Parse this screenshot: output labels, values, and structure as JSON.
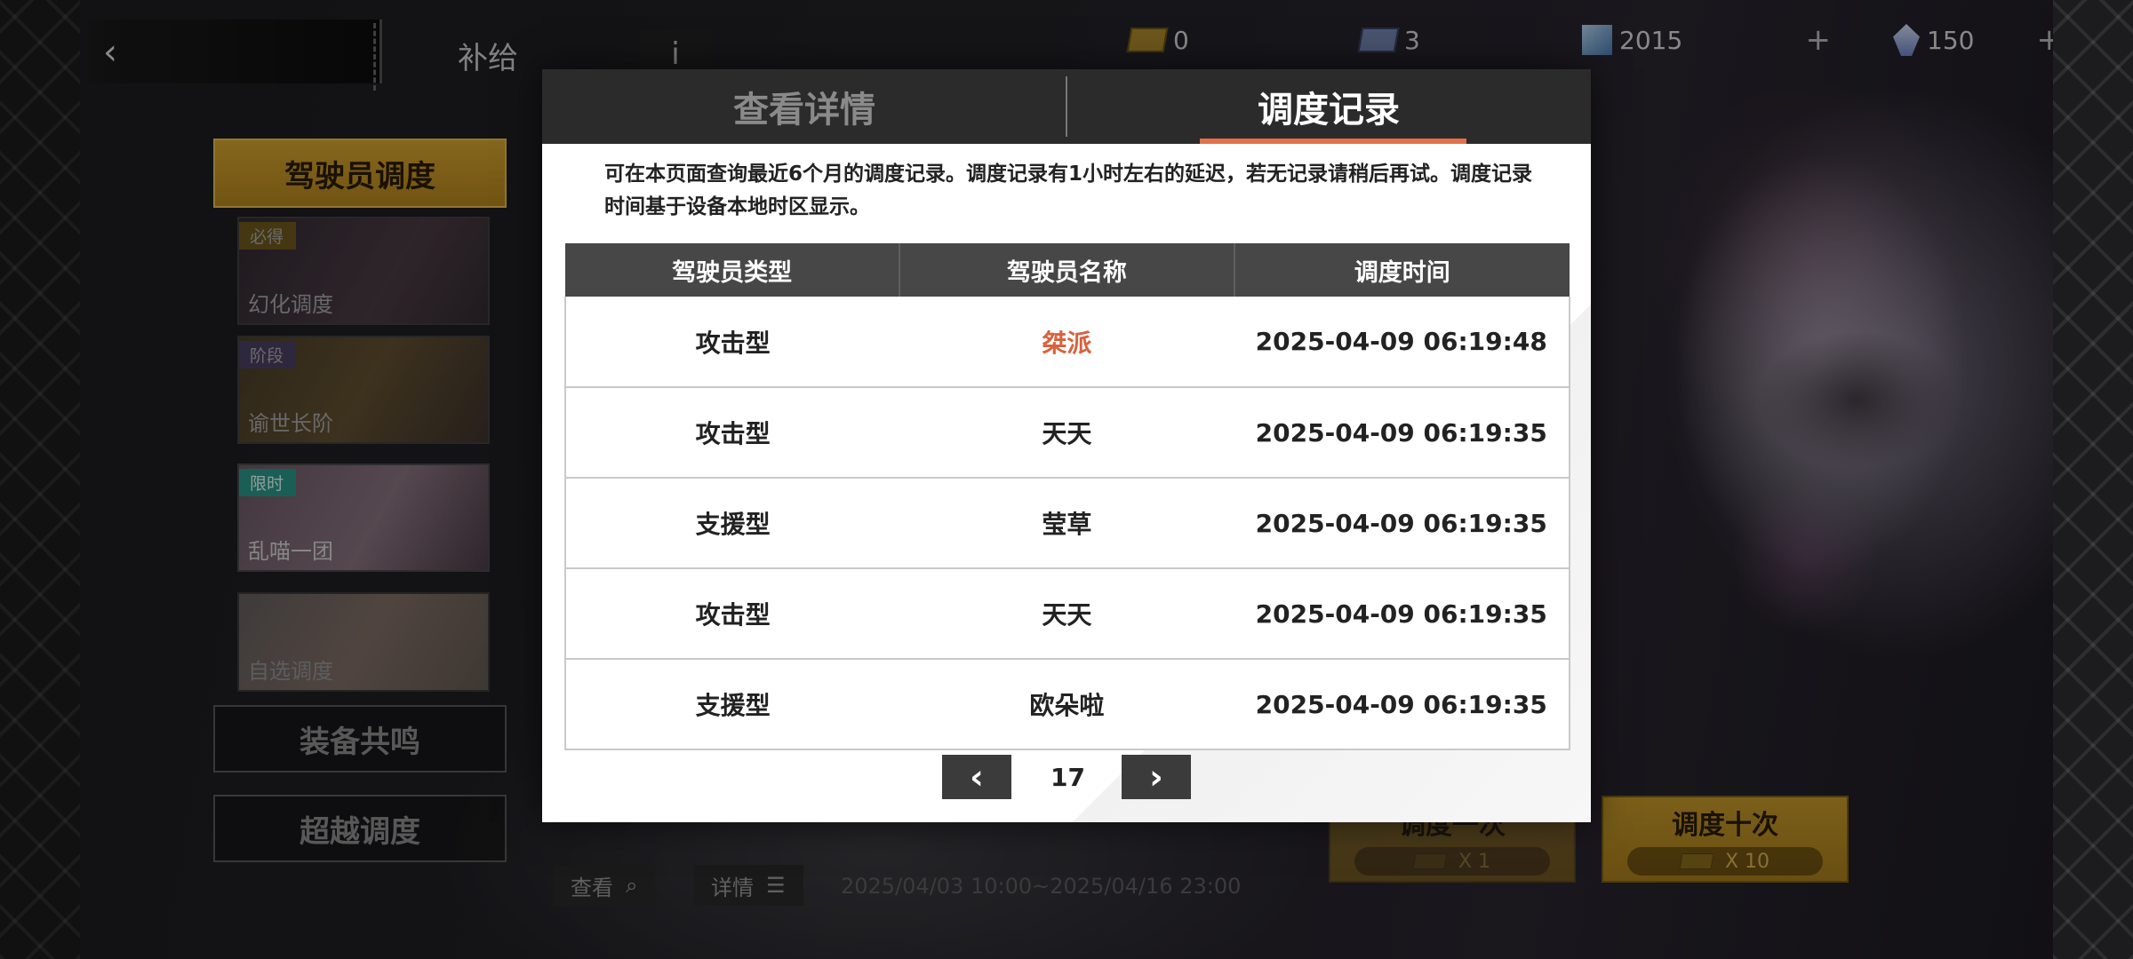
{
  "header": {
    "title": "补给",
    "info_label": "i",
    "resources": [
      {
        "icon": "ticket-icon",
        "value": "0",
        "has_plus": false
      },
      {
        "icon": "ticket-blue-icon",
        "value": "3",
        "has_plus": false
      },
      {
        "icon": "cube-icon",
        "value": "2015",
        "has_plus": true
      },
      {
        "icon": "crystal-icon",
        "value": "150",
        "has_plus": true
      }
    ],
    "plus_label": "+"
  },
  "sidebar": {
    "active_label": "驾驶员调度",
    "banners": [
      {
        "tag": "必得",
        "name": "幻化调度"
      },
      {
        "tag": "阶段",
        "name": "谕世长阶"
      },
      {
        "tag": "限时",
        "name": "乱喵一团"
      },
      {
        "tag": "",
        "name": "自选调度"
      }
    ],
    "buttons": [
      "装备共鸣",
      "超越调度"
    ]
  },
  "bottom": {
    "view_label": "查看",
    "details_label": "详情",
    "date_range": "2025/04/03 10:00~2025/04/16 23:00",
    "draw_one_label": "调度一次",
    "draw_one_cost": "X 1",
    "draw_ten_label": "调度十次",
    "draw_ten_cost": "X 10"
  },
  "modal": {
    "tabs": {
      "details": "查看详情",
      "records": "调度记录"
    },
    "active_tab": "records",
    "notice": "可在本页面查询最近6个月的调度记录。调度记录有1小时左右的延迟，若无记录请稍后再试。调度记录时间基于设备本地时区显示。",
    "columns": [
      "驾驶员类型",
      "驾驶员名称",
      "调度时间"
    ],
    "rows": [
      {
        "type": "攻击型",
        "name": "桀派",
        "time": "2025-04-09 06:19:48",
        "highlight": true
      },
      {
        "type": "攻击型",
        "name": "天天",
        "time": "2025-04-09 06:19:35",
        "highlight": false
      },
      {
        "type": "支援型",
        "name": "莹草",
        "time": "2025-04-09 06:19:35",
        "highlight": false
      },
      {
        "type": "攻击型",
        "name": "天天",
        "time": "2025-04-09 06:19:35",
        "highlight": false
      },
      {
        "type": "支援型",
        "name": "欧朵啦",
        "time": "2025-04-09 06:19:35",
        "highlight": false
      }
    ],
    "page": "17",
    "colors": {
      "accent": "#e3714a",
      "highlight_text": "#d9613d",
      "gold": "#c79a2a"
    }
  }
}
